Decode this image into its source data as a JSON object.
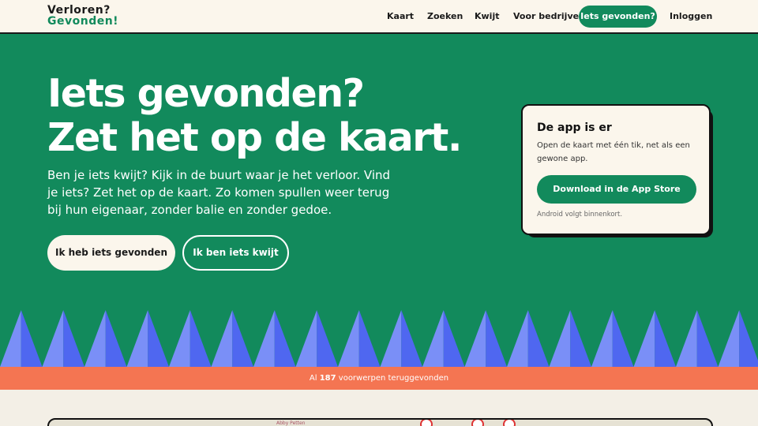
{
  "header": {
    "logo_line1": "Verloren?",
    "logo_line2": "Gevonden!",
    "nav": {
      "map": "Kaart",
      "search": "Zoeken",
      "lost": "Kwijt",
      "business": "Voor bedrijven",
      "found_cta": "Iets gevonden?",
      "login": "Inloggen"
    }
  },
  "hero": {
    "title_line1": "Iets gevonden?",
    "title_line2": "Zet het op de kaart.",
    "subtitle": "Ben je iets kwijt? Kijk in de buurt waar je het verloor. Vind je iets? Zet het op de kaart. Zo komen spullen weer terug bij hun eigenaar, zonder balie en zonder gedoe.",
    "primary_button": "Ik heb iets gevonden",
    "secondary_button": "Ik ben iets kwijt"
  },
  "app_card": {
    "title": "De app is er",
    "text": "Open de kaart met één tik, net als een gewone app.",
    "button": "Download in de App Store",
    "note": "Android volgt binnenkort."
  },
  "stats": {
    "prefix": "Al",
    "count": "187",
    "suffix": "voorwerpen teruggevonden"
  },
  "map_preview": {
    "place_label": "Abby Petten"
  },
  "colors": {
    "brand_green": "#128a5c",
    "cream": "#fbf6ec",
    "coral": "#f47552",
    "triangle_dark": "#4f67f0",
    "triangle_light": "#7a8ff7"
  }
}
